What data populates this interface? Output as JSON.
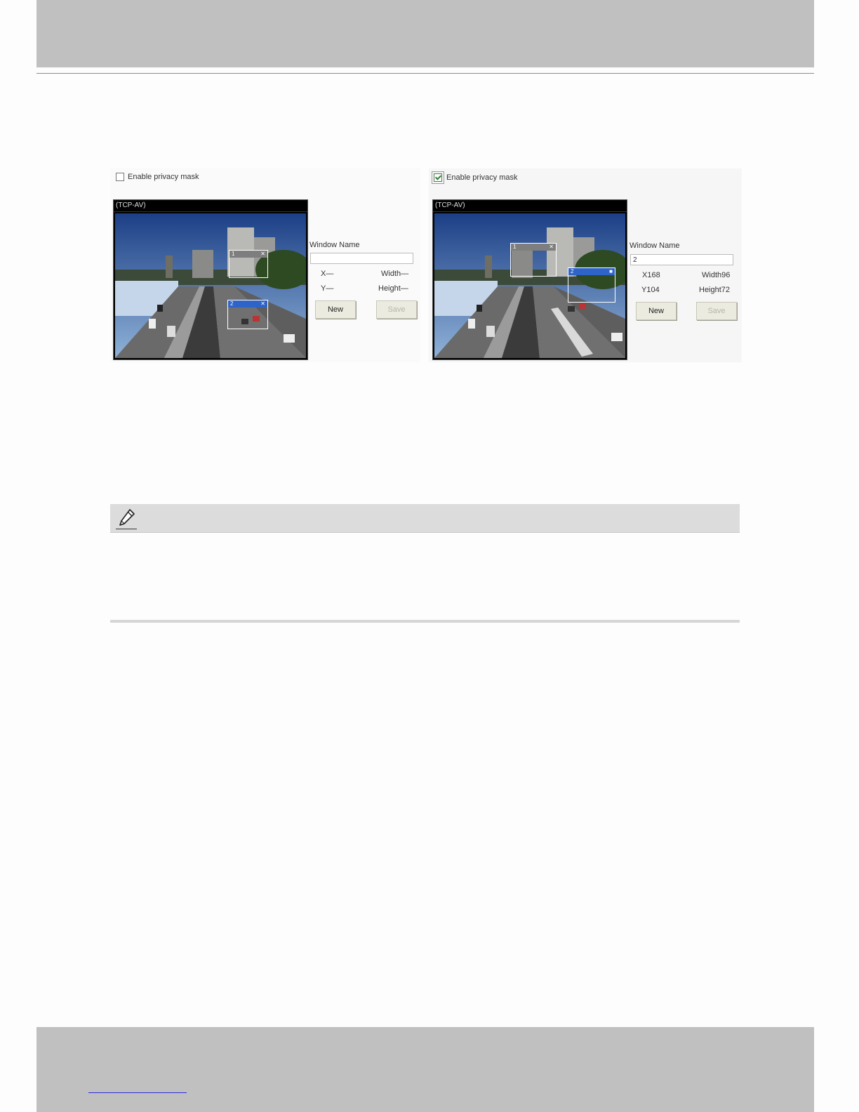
{
  "left_panel": {
    "enable_label": "Enable privacy mask",
    "enabled": false,
    "stream_label": "(TCP-AV)",
    "mask_gray_title": "1",
    "mask_blue_title": "2",
    "mask_close_glyph": "✕",
    "window_name_label": "Window Name",
    "window_name_value": "",
    "x_label": "X—",
    "y_label": "Y—",
    "width_label": "Width—",
    "height_label": "Height—",
    "new_button": "New",
    "save_button": "Save"
  },
  "right_panel": {
    "enable_label": "Enable privacy mask",
    "enabled": true,
    "stream_label": "(TCP-AV)",
    "mask_gray_title": "1",
    "mask_blue_title": "2",
    "mask_close_glyph": "✕",
    "mask_blue_close_glyph": "■",
    "window_name_label": "Window Name",
    "window_name_value": "2",
    "x_label": "X168",
    "y_label": "Y104",
    "width_label": "Width96",
    "height_label": "Height72",
    "new_button": "New",
    "save_button": "Save"
  },
  "note": {
    "icon": "pencil-icon"
  },
  "colors": {
    "band": "#c0c0c0",
    "mask_selected": "#2e63c8",
    "mask_unselected": "#7e7e7e",
    "link": "#2a2ae0"
  }
}
